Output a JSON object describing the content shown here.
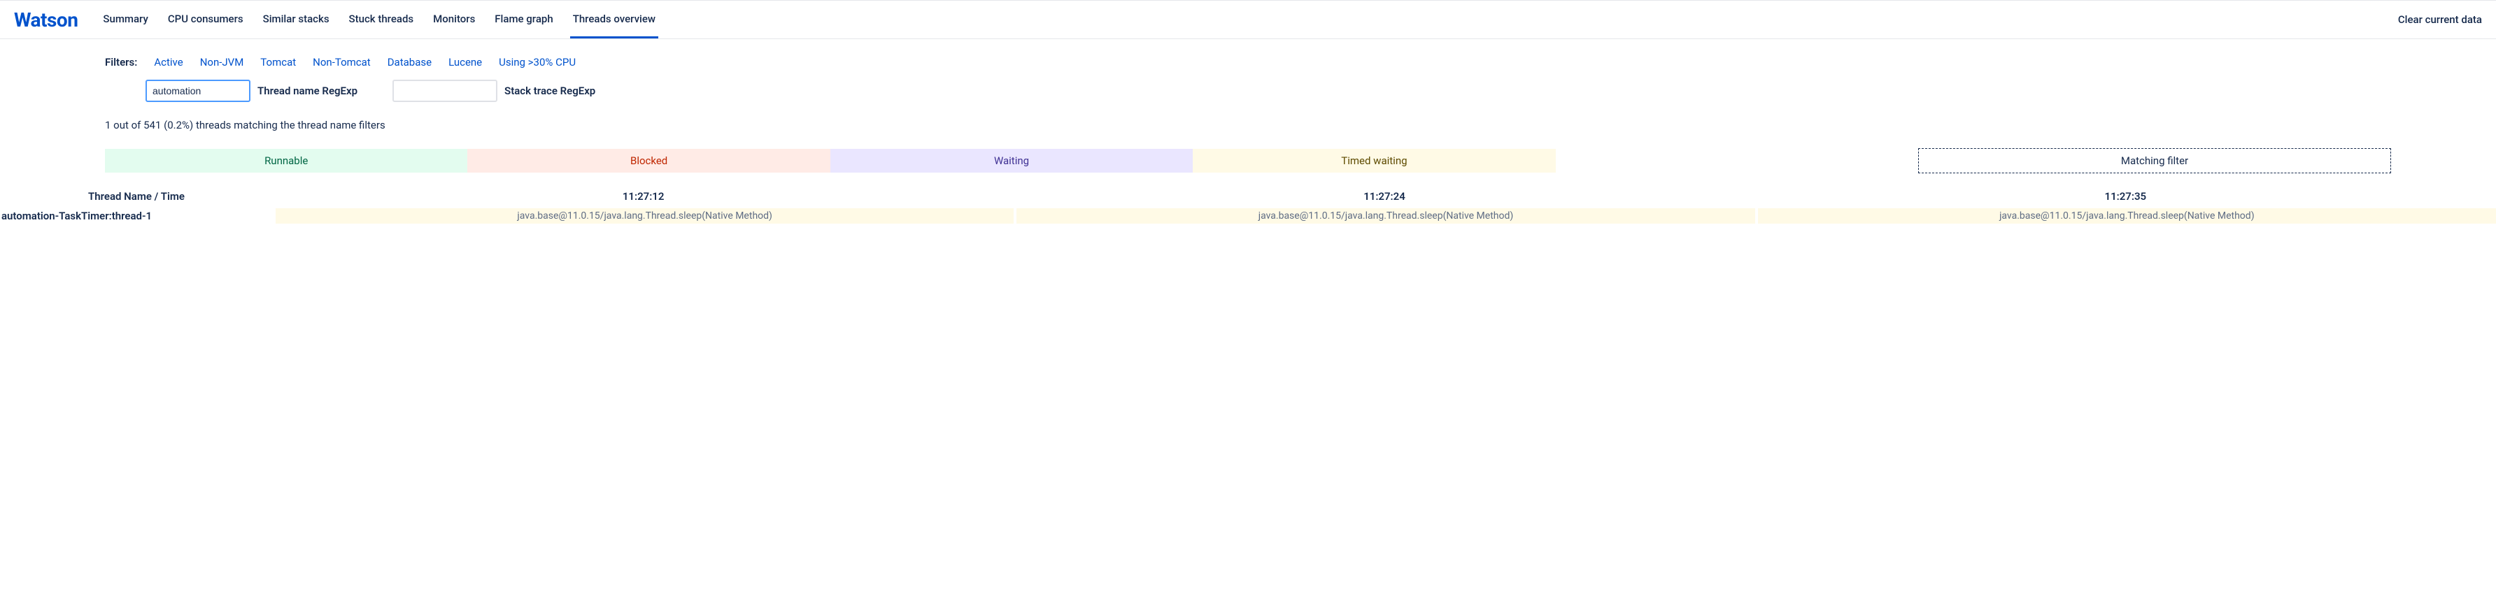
{
  "logo": "Watson",
  "nav": {
    "items": [
      {
        "label": "Summary"
      },
      {
        "label": "CPU consumers"
      },
      {
        "label": "Similar stacks"
      },
      {
        "label": "Stuck threads"
      },
      {
        "label": "Monitors"
      },
      {
        "label": "Flame graph"
      },
      {
        "label": "Threads overview"
      }
    ],
    "active_index": 6,
    "clear_label": "Clear current data"
  },
  "filters": {
    "label": "Filters:",
    "items": [
      "Active",
      "Non-JVM",
      "Tomcat",
      "Non-Tomcat",
      "Database",
      "Lucene",
      "Using >30% CPU"
    ],
    "thread_name_input": "automation",
    "thread_name_label": "Thread name RegExp",
    "stack_trace_input": "",
    "stack_trace_label": "Stack trace RegExp"
  },
  "status_line": "1 out of 541 (0.2%) threads matching the thread name filters",
  "legend": {
    "runnable": "Runnable",
    "blocked": "Blocked",
    "waiting": "Waiting",
    "timed": "Timed waiting",
    "matching": "Matching filter"
  },
  "table": {
    "header_name": "Thread Name / Time",
    "time_columns": [
      "11:27:12",
      "11:27:24",
      "11:27:35"
    ],
    "rows": [
      {
        "name": "automation-TaskTimer:thread-1",
        "cells": [
          "java.base@11.0.15/java.lang.Thread.sleep(Native Method)",
          "java.base@11.0.15/java.lang.Thread.sleep(Native Method)",
          "java.base@11.0.15/java.lang.Thread.sleep(Native Method)"
        ]
      }
    ]
  }
}
